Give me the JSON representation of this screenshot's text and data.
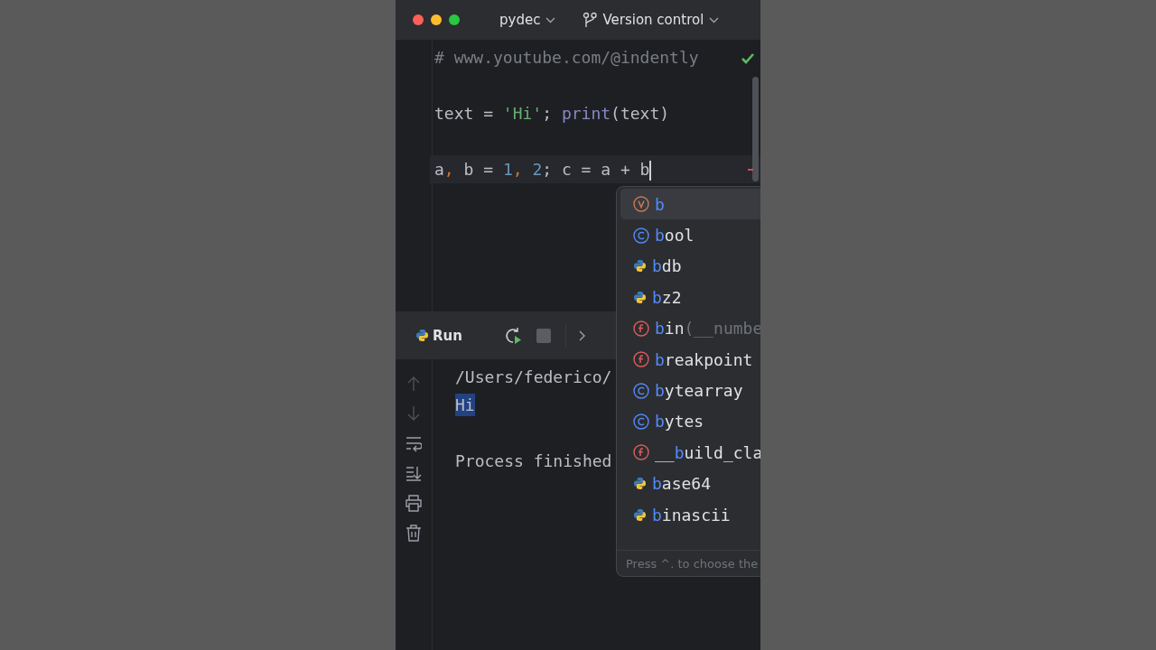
{
  "title_bar": {
    "project": "pydec",
    "vcs": "Version control"
  },
  "editor": {
    "checks_passed": true,
    "lines": [
      {
        "current": false,
        "tokens": [
          {
            "kind": "comment",
            "text": "# www.youtube.com/@indently"
          }
        ]
      },
      {
        "current": false,
        "tokens": [
          {
            "kind": "plain",
            "text": "text = "
          },
          {
            "kind": "string",
            "text": "'Hi'"
          },
          {
            "kind": "plain",
            "text": "; "
          },
          {
            "kind": "builtin",
            "text": "print"
          },
          {
            "kind": "plain",
            "text": "(text)"
          }
        ]
      },
      {
        "current": true,
        "tokens": [
          {
            "kind": "plain",
            "text": "a"
          },
          {
            "kind": "punct",
            "text": ","
          },
          {
            "kind": "plain",
            "text": " b = "
          },
          {
            "kind": "number",
            "text": "1"
          },
          {
            "kind": "punct",
            "text": ", "
          },
          {
            "kind": "number",
            "text": "2"
          },
          {
            "kind": "plain",
            "text": "; c = a + b"
          }
        ]
      }
    ]
  },
  "completion": {
    "items": [
      {
        "kind": "variable",
        "selected": true,
        "match": "b"
      },
      {
        "kind": "class",
        "selected": false,
        "match": "b",
        "after": "ool"
      },
      {
        "kind": "module",
        "selected": false,
        "match": "b",
        "after": "db"
      },
      {
        "kind": "module",
        "selected": false,
        "match": "b",
        "after": "z2"
      },
      {
        "kind": "function",
        "selected": false,
        "match": "b",
        "after": "in",
        "hint": "(__numbe"
      },
      {
        "kind": "function",
        "selected": false,
        "match": "b",
        "after": "reakpoint"
      },
      {
        "kind": "class",
        "selected": false,
        "match": "b",
        "after": "ytearray"
      },
      {
        "kind": "class",
        "selected": false,
        "match": "b",
        "after": "ytes"
      },
      {
        "kind": "function",
        "selected": false,
        "before": "__",
        "match": "b",
        "after": "uild_cla"
      },
      {
        "kind": "module",
        "selected": false,
        "match": "b",
        "after": "ase64"
      },
      {
        "kind": "module",
        "selected": false,
        "match": "b",
        "after": "inascii"
      }
    ],
    "footer": "Press ^. to choose the"
  },
  "run_panel": {
    "title": "Run",
    "stop_disabled": true,
    "console": [
      {
        "text": "/Users/federico/",
        "selected": false
      },
      {
        "text": "Hi",
        "selected": true
      },
      {
        "text": "Process finished",
        "selected": false
      }
    ]
  }
}
